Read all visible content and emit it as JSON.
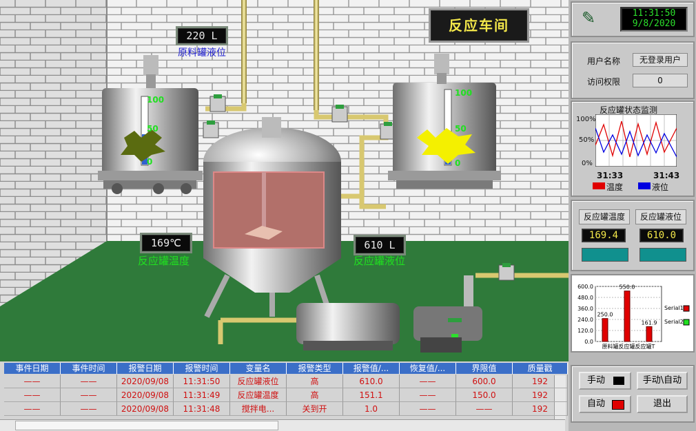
{
  "scene": {
    "title": "反应车间",
    "raw_tank": {
      "level_readout": "220 L",
      "caption": "原料罐液位",
      "scale": [
        "100",
        "50",
        "0"
      ]
    },
    "reactor_temp": {
      "readout": "169℃",
      "caption": "反应罐温度"
    },
    "reactor_level": {
      "readout": "610 L",
      "caption": "反应罐液位"
    },
    "product_tank": {
      "scale": [
        "100",
        "50",
        "0"
      ]
    }
  },
  "sidebar": {
    "time": "11:31:50",
    "date": "9/8/2020",
    "user_label": "用户名称",
    "user_value": "无登录用户",
    "perm_label": "访问权限",
    "perm_value": "0",
    "trend": {
      "title": "反应罐状态监测",
      "y_labels": [
        "100%",
        "50%",
        "0%"
      ],
      "t_start": "31:33",
      "t_end": "31:43",
      "legend_temp": "温度",
      "legend_level": "液位"
    },
    "temp_label": "反应罐温度",
    "temp_value": "169.4",
    "level_label": "反应罐液位",
    "level_value": "610.0",
    "mini_chart": {
      "y_labels": [
        "600.0",
        "480.0",
        "360.0",
        "240.0",
        "120.0",
        "0.0"
      ],
      "bar_values": [
        "250.0",
        "550.0",
        "161.9"
      ],
      "x_label": "原料罐反应罐反应罐T",
      "legend1": "Serial1",
      "legend2": "Serial2"
    },
    "manual_label": "手动",
    "auto_label": "自动",
    "switch_label": "手动\\自动",
    "exit_label": "退出"
  },
  "colors": {
    "table_header": "#3b6fc8",
    "alarm_text": "#d01010",
    "floor": "#2f7a3a",
    "trend_temp": "#e00000",
    "trend_level": "#0000e0"
  },
  "chart_data": {
    "type": "bar",
    "categories": [
      "原料罐",
      "反应罐",
      "反应罐T"
    ],
    "values": [
      250.0,
      550.0,
      161.9
    ],
    "ylim": [
      0,
      600
    ],
    "series": [
      {
        "name": "Serial1",
        "values": [
          250.0,
          550.0,
          161.9
        ]
      },
      {
        "name": "Serial2",
        "values": []
      }
    ]
  },
  "table": {
    "headers": [
      "事件日期",
      "事件时间",
      "报警日期",
      "报警时间",
      "变量名",
      "报警类型",
      "报警值/...",
      "恢复值/...",
      "界限值",
      "质量戳"
    ],
    "rows": [
      [
        "——",
        "——",
        "2020/09/08",
        "11:31:50",
        "反应罐液位",
        "高",
        "610.0",
        "——",
        "600.0",
        "192"
      ],
      [
        "——",
        "——",
        "2020/09/08",
        "11:31:49",
        "反应罐温度",
        "高",
        "151.1",
        "——",
        "150.0",
        "192"
      ],
      [
        "——",
        "——",
        "2020/09/08",
        "11:31:48",
        "搅拌电...",
        "关到开",
        "1.0",
        "——",
        "——",
        "192"
      ]
    ]
  }
}
